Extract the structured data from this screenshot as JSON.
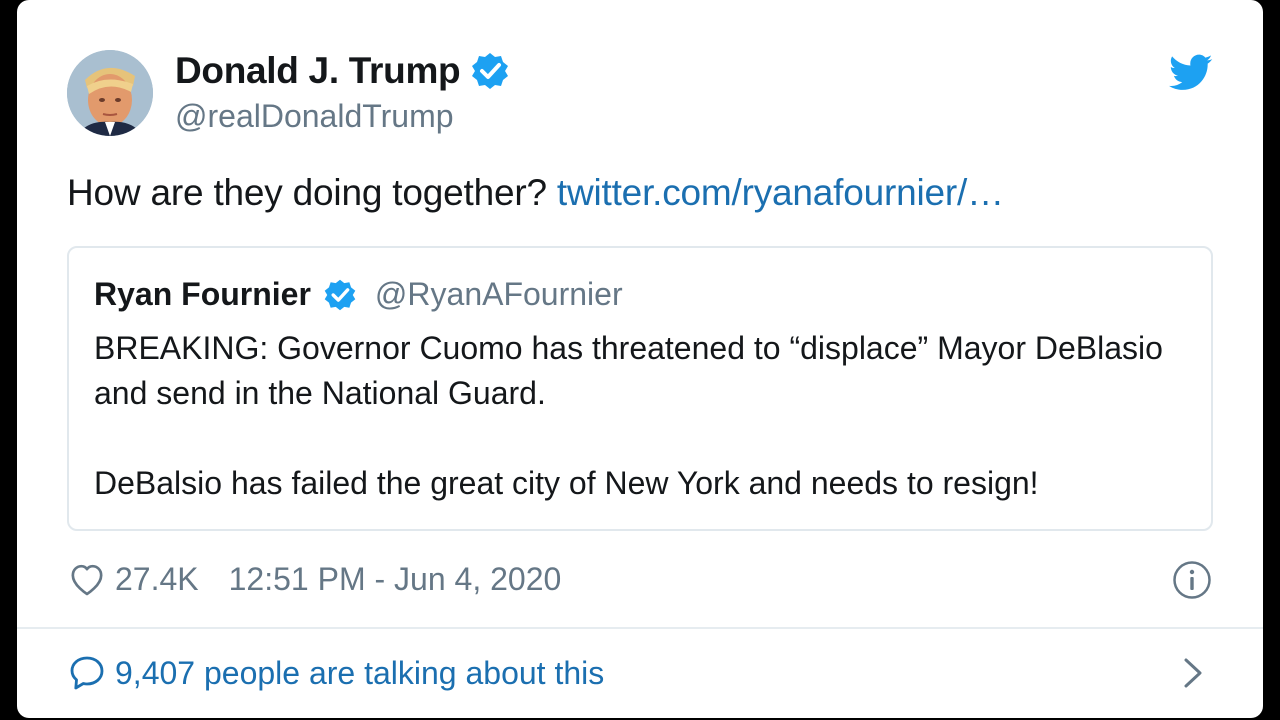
{
  "author": {
    "name": "Donald J. Trump",
    "handle": "@realDonaldTrump",
    "verified": true,
    "avatar_icon": "portrait-avatar"
  },
  "tweet": {
    "text": "How are they doing together? ",
    "link": "twitter.com/ryanafournier/…"
  },
  "quoted_tweet": {
    "name": "Ryan Fournier",
    "handle": "@RyanAFournier",
    "verified": true,
    "paragraphs": [
      "BREAKING: Governor Cuomo has threatened to “displace” Mayor DeBlasio and send in the National Guard.",
      "DeBalsio has failed the great city of New York and needs to resign!"
    ]
  },
  "meta": {
    "likes": "27.4K",
    "timestamp": "12:51 PM - Jun 4, 2020"
  },
  "footer": {
    "talking_label": "9,407 people are talking about this"
  },
  "colors": {
    "brand_blue": "#1da1f2",
    "link_blue": "#1b6fb0",
    "text": "#14171a",
    "muted": "#657786",
    "border": "#e1e8ed"
  },
  "icons": [
    "twitter-bird-icon",
    "verified-badge-icon",
    "heart-icon",
    "info-icon",
    "speech-bubble-icon",
    "chevron-right-icon"
  ]
}
